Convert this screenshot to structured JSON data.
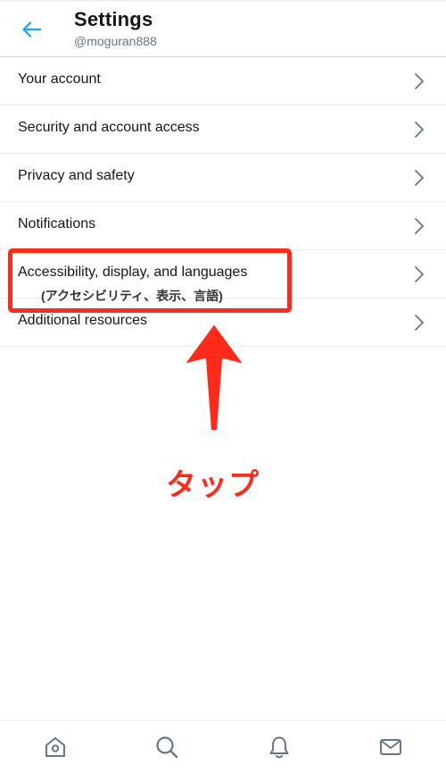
{
  "header": {
    "title": "Settings",
    "username": "@moguran888",
    "back_icon": "arrow-left-icon",
    "accent": "#1da1f2"
  },
  "settings_items": [
    {
      "label": "Your account"
    },
    {
      "label": "Security and account access"
    },
    {
      "label": "Privacy and safety"
    },
    {
      "label": "Notifications"
    },
    {
      "label": "Accessibility, display, and languages"
    },
    {
      "label": "Additional resources"
    }
  ],
  "annotation": {
    "highlighted_item": "Accessibility, display, and languages",
    "note": "(アクセシビリティ、表示、言語)",
    "tap_label": "タップ",
    "color": "#ff2a1a"
  },
  "tabbar": {
    "tabs": [
      {
        "icon": "home-icon"
      },
      {
        "icon": "search-icon"
      },
      {
        "icon": "bell-icon"
      },
      {
        "icon": "mail-icon"
      }
    ]
  }
}
